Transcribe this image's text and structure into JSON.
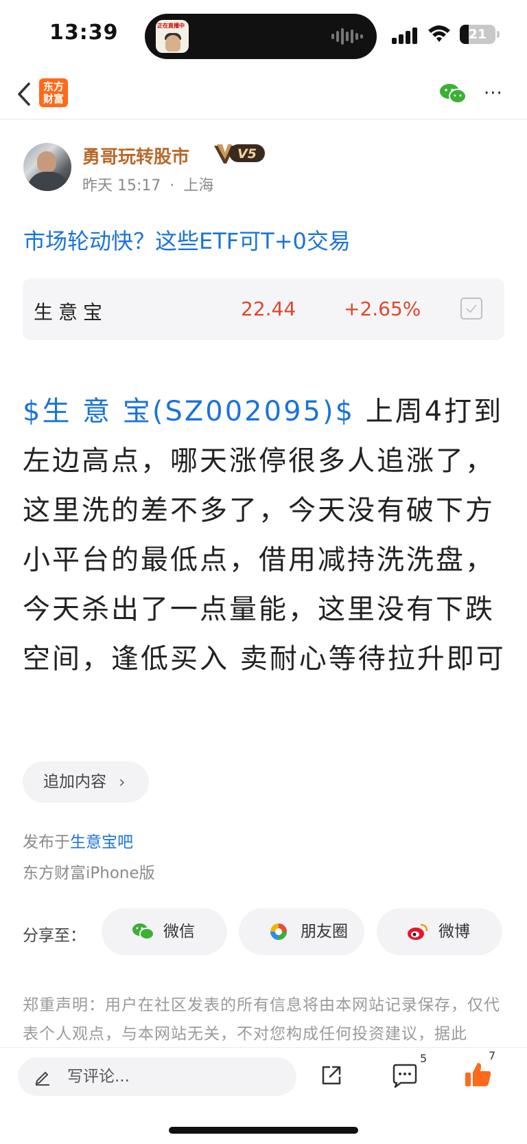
{
  "status_bar": {
    "time": "13:39",
    "live_thumb_label": "正在直播中",
    "battery_level": "21"
  },
  "nav": {
    "app_logo_text": "东方财富",
    "more_label": "···"
  },
  "author": {
    "name": "勇哥玩转股市",
    "vip_level": "V5",
    "post_time": "昨天 15:17",
    "post_location": "上海",
    "separator": "·"
  },
  "post": {
    "title_link": "市场轮动快？这些ETF可T+0交易",
    "stock_tag": "$生 意 宝(SZ002095)$",
    "body": " 上周4打到左边高点，哪天涨停很多人追涨了，这里洗的差不多了，今天没有破下方小平台的最低点，借用减持洗洗盘，今天杀出了一点量能，这里没有下跌空间，逢低买入 卖耐心等待拉升即可",
    "append_label": "追加内容",
    "append_chevron": "›",
    "published_prefix": "发布于",
    "published_bar": "生意宝吧",
    "client": "东方财富iPhone版"
  },
  "stock_card": {
    "name": "生意宝",
    "price": "22.44",
    "change": "+2.65%",
    "accent_color": "#e0452b"
  },
  "share": {
    "label": "分享至：",
    "wechat": "微信",
    "moments": "朋友圈",
    "weibo": "微博"
  },
  "disclaimer": "郑重声明：用户在社区发表的所有信息将由本网站记录保存，仅代表个人观点，与本网站无关，不对您构成任何投资建议，据此",
  "bottom_bar": {
    "comment_placeholder": "写评论...",
    "comment_count": "5",
    "like_count": "7"
  },
  "colors": {
    "link_blue": "#1a73d9",
    "brand_orange": "#ff6a1a",
    "author_gold": "#b8692a"
  }
}
